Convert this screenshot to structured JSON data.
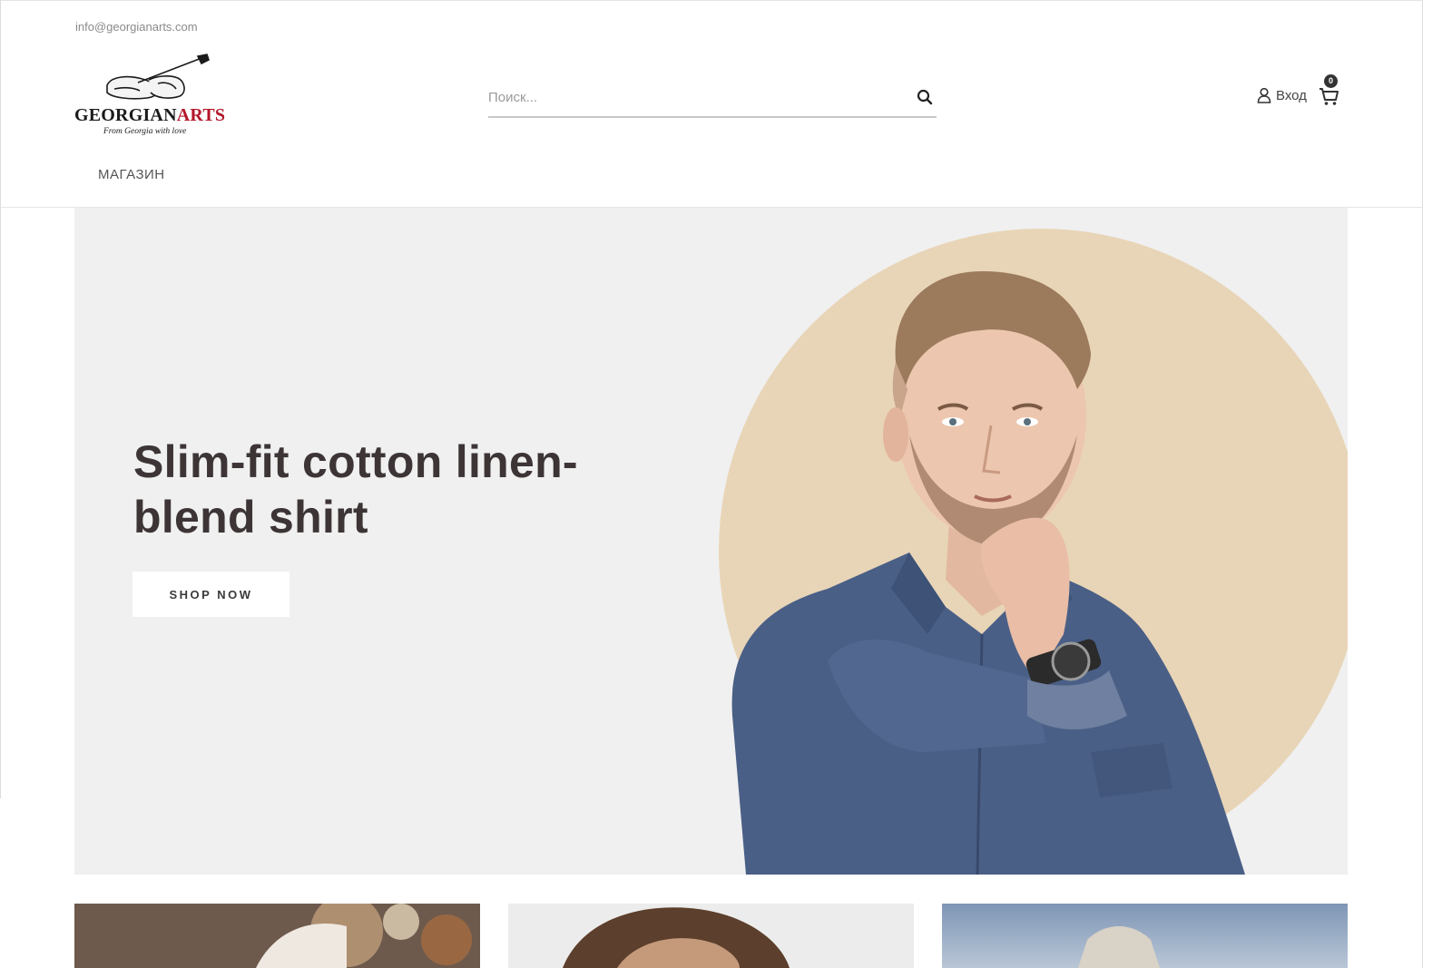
{
  "header": {
    "email": "info@georgianarts.com",
    "logo": {
      "word_part1": "GEORGIAN",
      "word_part2": "ARTS",
      "tagline": "From Georgia with love",
      "icon": "panduri-logo-icon"
    },
    "search": {
      "placeholder": "Поиск...",
      "value": "",
      "icon": "search-icon"
    },
    "account": {
      "login_label": "Вход",
      "icon": "user-icon"
    },
    "cart": {
      "count": "0",
      "icon": "cart-icon"
    },
    "nav": [
      {
        "label": "МАГАЗИН"
      }
    ]
  },
  "hero": {
    "title": "Slim-fit cotton linen-blend shirt",
    "cta_label": "SHOP NOW",
    "background_color": "#f0f0f0",
    "circle_color": "#e8d5b7",
    "shirt_color": "#4a5f86"
  },
  "cards": [
    {
      "name": "promo-card-1",
      "color": "#6e5a4c"
    },
    {
      "name": "promo-card-2",
      "color": "#ececec"
    },
    {
      "name": "promo-card-3",
      "color": "#8fa3bd"
    }
  ],
  "colors": {
    "text_dark": "#3d3535",
    "accent_red": "#b3172a"
  }
}
